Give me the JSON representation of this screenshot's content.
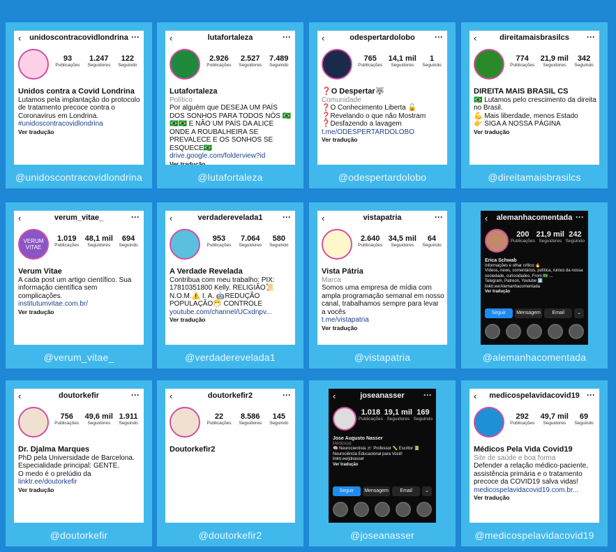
{
  "labels": {
    "posts": "Publicações",
    "followers": "Seguidores",
    "following": "Seguindo",
    "translate": "Ver tradução",
    "more": "mais"
  },
  "profiles": [
    {
      "username": "unidoscontracovidlondrina",
      "posts": "93",
      "followers": "1.247",
      "following": "122",
      "name": "Unidos contra a Covid Londrina",
      "bio": [
        "Lutamos pela implantação do protocolo de tratamento precoce contra o Coronavirus em Londrina."
      ],
      "link": "#unidoscontracovidlondrina",
      "handle": "@unidoscontracovidlondrina"
    },
    {
      "username": "lutafortaleza",
      "posts": "2.926",
      "followers": "2.527",
      "following": "7.489",
      "name": "Lutafortaleza",
      "category": "Político",
      "bio": [
        "Por alguém que DESEJA UM PAÍS DOS SONHOS PARA TODOS NÓS 🇧🇷🇧🇷🇧🇷 E NÃO UM PAÍS DA ALICE ONDE A ROUBALHEIRA SE PREVALECE E OS SONHOS SE ESQUECE🇧🇷"
      ],
      "link": "drive.google.com/folderview?id",
      "handle": "@lutafortaleza"
    },
    {
      "username": "odespertardolobo",
      "posts": "765",
      "followers": "14,1 mil",
      "following": "1",
      "name": "❓O Despertar🐺",
      "category": "Comunidade",
      "bio": [
        "❓O Conhecimento Liberta 🔓",
        "❓Revelando o que não Mostram",
        "❓Desfazendo a lavagem"
      ],
      "link": "t.me/ODESPERTARDOLOBO",
      "handle": "@odespertardolobo"
    },
    {
      "username": "direitamaisbrasilcs",
      "posts": "774",
      "followers": "21,9 mil",
      "following": "342",
      "name": "DIREITA MAIS BRASIL CS",
      "bio": [
        "🇧🇷 Lutamos pelo crescimento da direita no Brasil.",
        "💪 Mais liberdade, menos Estado",
        "👉 SIGA A NOSSA PÁGINA"
      ],
      "handle": "@direitamaisbrasilcs"
    },
    {
      "username": "verum_vitae_",
      "posts": "1.019",
      "followers": "48,1 mil",
      "following": "694",
      "name": "Verum Vitae",
      "avatar_text": "VERUM VITAE",
      "bio": [
        "A cada post um artigo científico. Sua informação científica sem complicações."
      ],
      "link": "institutumvitae.com.br/",
      "handle": "@verum_vitae_"
    },
    {
      "username": "verdaderevelada1",
      "posts": "953",
      "followers": "7.064",
      "following": "580",
      "name": "A Verdade Revelada",
      "bio": [
        "Contribua com meu trabalho: PIX: 17810351800 Kelly. RELIGIÃO📜 N.O.M.⚠️ I. A. 🤖REDUÇÃO POPULAÇÃO😷 CONTROLE"
      ],
      "link": "youtube.com/channel/UCxdnpv...",
      "handle": "@verdaderevelada1"
    },
    {
      "username": "vistapatria",
      "posts": "2.640",
      "followers": "34,5 mil",
      "following": "64",
      "name": "Vista Pátria",
      "category": "Marca",
      "bio": [
        "Somos uma empresa de mídia com ampla programação semanal em nosso canal, trabalhamos sempre para levar a vocês"
      ],
      "link": "t.me/vistapatria",
      "handle": "@vistapatria"
    },
    {
      "username": "alemanhacomentada",
      "posts": "200",
      "followers": "21,9 mil",
      "following": "242",
      "name": "Erica Schwab",
      "bio": [
        "Informações e olhar crítico 🔥",
        "Vídeos, news, comentários, política, rumos da nossa sociedade, curiosidades, From 🇧🇷 ...",
        "Telegram, Patreon, Youtube ⬇️",
        "linktr.ee/Alemanhacomentada"
      ],
      "buttons": [
        "Seguir",
        "Mensagem",
        "Email"
      ],
      "handle": "@alemanhacomentada"
    },
    {
      "username": "doutorkefir",
      "posts": "756",
      "followers": "49,6 mil",
      "following": "1.911",
      "name": "Dr. Djalma Marques",
      "bio": [
        "PhD pela Universidade de Barcelona.",
        "Especialidade principal: GENTE.",
        "O medo é o prelúdio da"
      ],
      "link": "linktr.ee/doutorkefir",
      "handle": "@doutorkefir"
    },
    {
      "username": "doutorkefir2",
      "posts": "22",
      "followers": "8.586",
      "following": "145",
      "name": "Doutorkefir2",
      "handle": "@doutorkefir2"
    },
    {
      "username": "joseanasser",
      "posts": "1.018",
      "followers": "19,1 mil",
      "following": "169",
      "name": "Jose Augusto Nasser",
      "category": "Médico(a)",
      "bio": [
        "🧠 Neurocientista 🎓 Professor ✏️ Escritor 📗",
        "Neurociência Educacional para Você!",
        "linktr.ee/jdnasser"
      ],
      "buttons": [
        "Seguir",
        "Mensagem",
        "Email"
      ],
      "handle": "@joseanasser"
    },
    {
      "username": "medicospelavidacovid19",
      "posts": "292",
      "followers": "49,7 mil",
      "following": "69",
      "name": "Médicos Pela Vida Covid19",
      "category": "Site de saúde e boa forma",
      "bio": [
        "Defender a relação médico-paciente, assistência primária e o tratamento precoce da COVID19 salva vidas!"
      ],
      "link": "medicospelavidacovid19.com.br...",
      "handle": "@medicospelavidacovid19"
    }
  ],
  "colors": {
    "background": "#1e88d6",
    "tile": "#41b8ec",
    "link": "#1b3f8c",
    "follow_button": "#1d8cf0"
  }
}
